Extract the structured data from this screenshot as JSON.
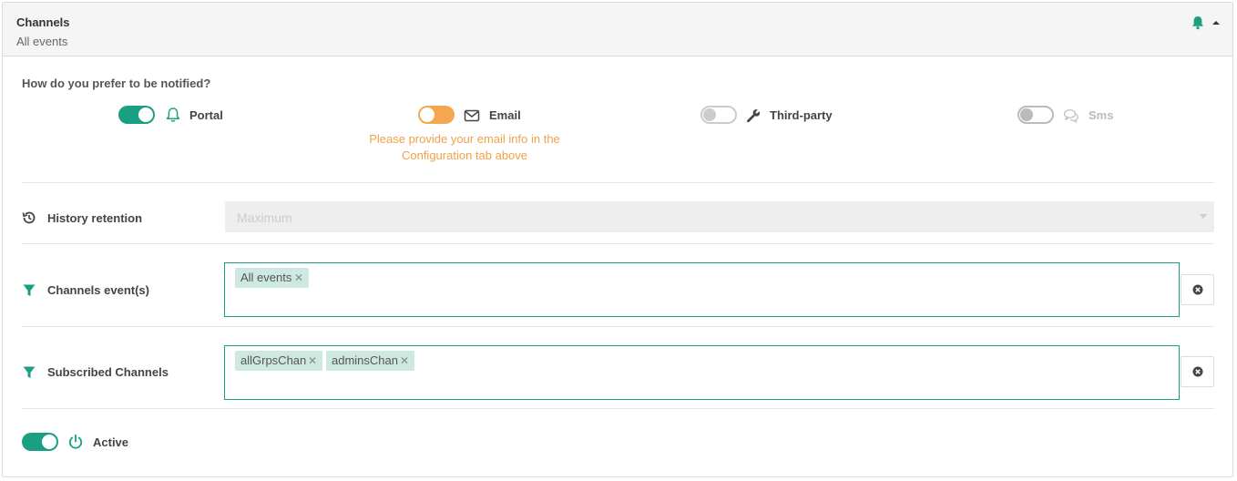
{
  "header": {
    "title": "Channels",
    "subtitle": "All events"
  },
  "question": "How do you prefer to be notified?",
  "channels": [
    {
      "label": "Portal",
      "state": "on",
      "icon": "bell-icon"
    },
    {
      "label": "Email",
      "state": "warning",
      "icon": "envelope-icon",
      "warning": "Please provide your email info in the Configuration tab above"
    },
    {
      "label": "Third-party",
      "state": "off",
      "icon": "wrench-icon"
    },
    {
      "label": "Sms",
      "state": "disabled",
      "icon": "chat-icon"
    }
  ],
  "history": {
    "label": "History retention",
    "value": "Maximum",
    "icon": "history-icon"
  },
  "channels_events": {
    "label": "Channels event(s)",
    "icon": "filter-icon",
    "tags": [
      "All events"
    ]
  },
  "subscribed": {
    "label": "Subscribed Channels",
    "icon": "filter-icon",
    "tags": [
      "allGrpsChan",
      "adminsChan"
    ]
  },
  "active": {
    "label": "Active",
    "state": "on",
    "icon": "power-icon"
  },
  "colors": {
    "accent": "#1a9f82",
    "warning": "#f0a24a",
    "tag_bg": "#cde9e1"
  }
}
